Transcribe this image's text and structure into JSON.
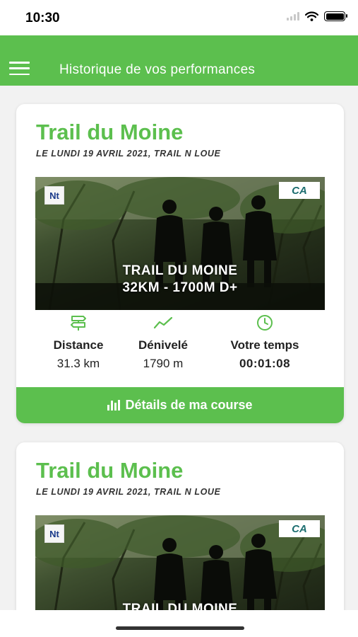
{
  "status_bar": {
    "time": "10:30"
  },
  "header": {
    "title": "Historique de vos performances",
    "menu_icon": "hamburger-menu-icon"
  },
  "colors": {
    "primary_green": "#5cbf4e",
    "background": "#f2f2f2"
  },
  "cards": [
    {
      "title": "Trail du Moine",
      "subtitle": "LE LUNDI 19 AVRIL 2021, TRAIL N LOUE",
      "poster": {
        "logo_left": "Nt",
        "logo_right": "CA",
        "line1": "TRAIL DU MOINE",
        "line2": "32KM - 1700M D+"
      },
      "stats": [
        {
          "icon": "route-signpost-icon",
          "label": "Distance",
          "value": "31.3 km"
        },
        {
          "icon": "elevation-trend-icon",
          "label": "Dénivelé",
          "value": "1790 m"
        },
        {
          "icon": "clock-icon",
          "label": "Votre temps",
          "value": "00:01:08"
        }
      ],
      "details_button": "Détails de ma course"
    },
    {
      "title": "Trail du Moine",
      "subtitle": "LE LUNDI 19 AVRIL 2021, TRAIL N LOUE",
      "poster": {
        "logo_left": "Nt",
        "logo_right": "CA",
        "line1": "TRAIL DU MOINE"
      }
    }
  ]
}
